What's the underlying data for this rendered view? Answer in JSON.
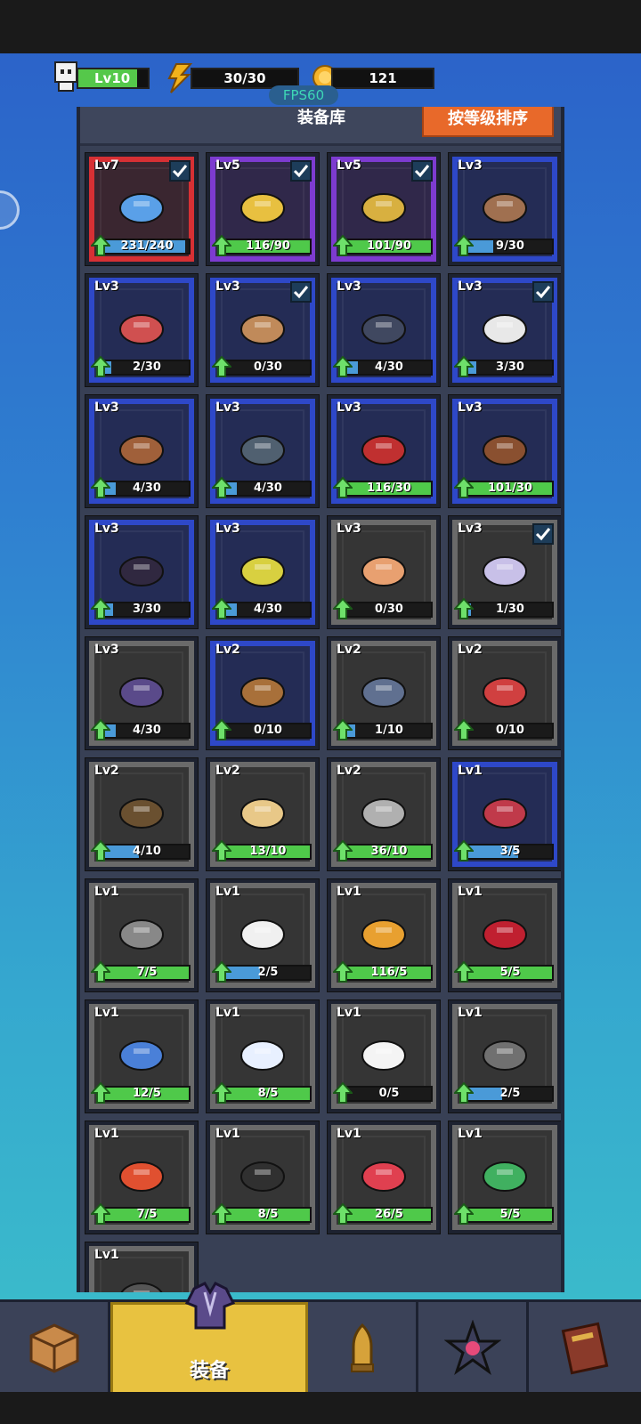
{
  "hud": {
    "level_label": "Lv10",
    "level_fill": 0.85,
    "energy": "30/30",
    "coins": "121",
    "fps": "FPS60"
  },
  "panel": {
    "title": "装备库",
    "sort_button": "按等级排序"
  },
  "items": [
    {
      "lv": "Lv7",
      "rarity": "red",
      "checked": true,
      "progress": "231/240",
      "fill": 0.96,
      "bar": "teal",
      "icon": "blue-claw-weapon-icon"
    },
    {
      "lv": "Lv5",
      "rarity": "purple",
      "checked": true,
      "progress": "116/90",
      "fill": 1,
      "bar": "green",
      "icon": "golden-gauntlet-icon"
    },
    {
      "lv": "Lv5",
      "rarity": "purple",
      "checked": true,
      "progress": "101/90",
      "fill": 1,
      "bar": "green",
      "icon": "golden-harp-icon"
    },
    {
      "lv": "Lv3",
      "rarity": "blue",
      "checked": false,
      "progress": "9/30",
      "fill": 0.3,
      "bar": "teal",
      "icon": "dark-glove-icon"
    },
    {
      "lv": "Lv3",
      "rarity": "blue",
      "checked": false,
      "progress": "2/30",
      "fill": 0.07,
      "bar": "teal",
      "icon": "red-necklace-icon"
    },
    {
      "lv": "Lv3",
      "rarity": "blue",
      "checked": true,
      "progress": "0/30",
      "fill": 0,
      "bar": "teal",
      "icon": "leather-boots-icon"
    },
    {
      "lv": "Lv3",
      "rarity": "blue",
      "checked": false,
      "progress": "4/30",
      "fill": 0.13,
      "bar": "teal",
      "icon": "spiked-boots-icon"
    },
    {
      "lv": "Lv3",
      "rarity": "blue",
      "checked": true,
      "progress": "3/30",
      "fill": 0.1,
      "bar": "teal",
      "icon": "hockey-mask-icon"
    },
    {
      "lv": "Lv3",
      "rarity": "blue",
      "checked": false,
      "progress": "4/30",
      "fill": 0.13,
      "bar": "teal",
      "icon": "spiked-club-icon"
    },
    {
      "lv": "Lv3",
      "rarity": "blue",
      "checked": false,
      "progress": "4/30",
      "fill": 0.13,
      "bar": "teal",
      "icon": "rifle-icon"
    },
    {
      "lv": "Lv3",
      "rarity": "blue",
      "checked": false,
      "progress": "116/30",
      "fill": 1,
      "bar": "green",
      "icon": "plunger-icon"
    },
    {
      "lv": "Lv3",
      "rarity": "blue",
      "checked": false,
      "progress": "101/30",
      "fill": 1,
      "bar": "green",
      "icon": "shotgun-icon"
    },
    {
      "lv": "Lv3",
      "rarity": "blue",
      "checked": false,
      "progress": "3/30",
      "fill": 0.1,
      "bar": "teal",
      "icon": "laser-gun-icon"
    },
    {
      "lv": "Lv3",
      "rarity": "blue",
      "checked": false,
      "progress": "4/30",
      "fill": 0.13,
      "bar": "teal",
      "icon": "big-cannon-icon"
    },
    {
      "lv": "Lv3",
      "rarity": "gray",
      "checked": false,
      "progress": "0/30",
      "fill": 0,
      "bar": "teal",
      "icon": "sneakers-icon"
    },
    {
      "lv": "Lv3",
      "rarity": "gray",
      "checked": true,
      "progress": "1/30",
      "fill": 0.03,
      "bar": "teal",
      "icon": "ghost-robe-icon"
    },
    {
      "lv": "Lv3",
      "rarity": "gray",
      "checked": false,
      "progress": "4/30",
      "fill": 0.13,
      "bar": "teal",
      "icon": "purple-armor-icon"
    },
    {
      "lv": "Lv2",
      "rarity": "blue",
      "checked": false,
      "progress": "0/10",
      "fill": 0,
      "bar": "teal",
      "icon": "straw-hat-icon"
    },
    {
      "lv": "Lv2",
      "rarity": "gray",
      "checked": false,
      "progress": "1/10",
      "fill": 0.1,
      "bar": "teal",
      "icon": "bead-necklace-icon"
    },
    {
      "lv": "Lv2",
      "rarity": "gray",
      "checked": false,
      "progress": "0/10",
      "fill": 0,
      "bar": "teal",
      "icon": "fang-necklace-icon"
    },
    {
      "lv": "Lv2",
      "rarity": "gray",
      "checked": false,
      "progress": "4/10",
      "fill": 0.4,
      "bar": "teal",
      "icon": "leather-cap-icon"
    },
    {
      "lv": "Lv2",
      "rarity": "gray",
      "checked": false,
      "progress": "13/10",
      "fill": 1,
      "bar": "green",
      "icon": "beast-head-icon"
    },
    {
      "lv": "Lv2",
      "rarity": "gray",
      "checked": false,
      "progress": "36/10",
      "fill": 1,
      "bar": "green",
      "icon": "mace-icon"
    },
    {
      "lv": "Lv1",
      "rarity": "blue",
      "checked": false,
      "progress": "3/5",
      "fill": 0.6,
      "bar": "teal",
      "icon": "red-boots-icon"
    },
    {
      "lv": "Lv1",
      "rarity": "gray",
      "checked": false,
      "progress": "7/5",
      "fill": 1,
      "bar": "green",
      "icon": "bandage-arm-icon"
    },
    {
      "lv": "Lv1",
      "rarity": "gray",
      "checked": false,
      "progress": "2/5",
      "fill": 0.4,
      "bar": "teal",
      "icon": "white-glove-icon"
    },
    {
      "lv": "Lv1",
      "rarity": "gray",
      "checked": false,
      "progress": "116/5",
      "fill": 1,
      "bar": "green",
      "icon": "amber-necklace-icon"
    },
    {
      "lv": "Lv1",
      "rarity": "gray",
      "checked": false,
      "progress": "5/5",
      "fill": 1,
      "bar": "green",
      "icon": "ruby-pendant-icon"
    },
    {
      "lv": "Lv1",
      "rarity": "gray",
      "checked": false,
      "progress": "12/5",
      "fill": 1,
      "bar": "green",
      "icon": "blue-jacket-icon"
    },
    {
      "lv": "Lv1",
      "rarity": "gray",
      "checked": false,
      "progress": "8/5",
      "fill": 1,
      "bar": "green",
      "icon": "white-coat-icon"
    },
    {
      "lv": "Lv1",
      "rarity": "gray",
      "checked": false,
      "progress": "0/5",
      "fill": 0,
      "bar": "teal",
      "icon": "white-cloth-icon"
    },
    {
      "lv": "Lv1",
      "rarity": "gray",
      "checked": false,
      "progress": "2/5",
      "fill": 0.4,
      "bar": "teal",
      "icon": "hammer-icon"
    },
    {
      "lv": "Lv1",
      "rarity": "gray",
      "checked": false,
      "progress": "7/5",
      "fill": 1,
      "bar": "green",
      "icon": "syringe-icon"
    },
    {
      "lv": "Lv1",
      "rarity": "gray",
      "checked": false,
      "progress": "8/5",
      "fill": 1,
      "bar": "green",
      "icon": "katana-icon"
    },
    {
      "lv": "Lv1",
      "rarity": "gray",
      "checked": false,
      "progress": "26/5",
      "fill": 1,
      "bar": "green",
      "icon": "shield-icon"
    },
    {
      "lv": "Lv1",
      "rarity": "gray",
      "checked": false,
      "progress": "5/5",
      "fill": 1,
      "bar": "green",
      "icon": "toy-blaster-icon"
    },
    {
      "lv": "Lv1",
      "rarity": "gray",
      "checked": false,
      "progress": "",
      "fill": 0,
      "bar": "teal",
      "icon": "partial-item-icon"
    }
  ],
  "nav": {
    "tabs": [
      {
        "name": "crate-tab",
        "label": "",
        "icon": "crate-icon"
      },
      {
        "name": "equipment-tab",
        "label": "装备",
        "icon": "armor-icon",
        "active": true
      },
      {
        "name": "ammo-tab",
        "label": "",
        "icon": "bullet-icon"
      },
      {
        "name": "gem-tab",
        "label": "",
        "icon": "star-gem-icon"
      },
      {
        "name": "book-tab",
        "label": "",
        "icon": "book-icon"
      }
    ]
  },
  "colors": {
    "red": "#d63034",
    "purple": "#7d3bd0",
    "blue": "#2e48c8",
    "gray": "#6a6a6a",
    "bar_green": "#4fc94a",
    "bar_teal": "#4a9ad8",
    "accent": "#e8692a",
    "active_tab": "#e8c240"
  }
}
